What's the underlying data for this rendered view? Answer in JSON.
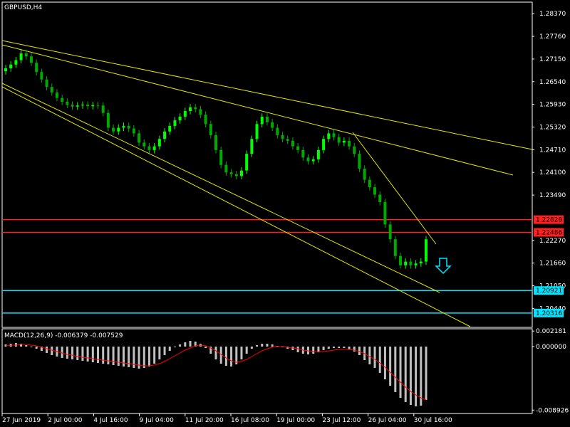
{
  "symbol_label": "GBPUSD,H4",
  "macd_label": "MACD(12,26,9) -0.006379 -0.007529",
  "colors": {
    "background": "#000000",
    "frame": "#ffffff",
    "bull_candle": "#00ff00",
    "bear_candle": "#00aa00",
    "trendline": "#e6e600",
    "resistance": "#ff2020",
    "support": "#00e5ff",
    "macd_hist": "#c0c0c0",
    "macd_signal": "#ff0000",
    "arrow": "#00e5ff"
  },
  "price_axis": {
    "min": 1.1993,
    "max": 1.2868,
    "ticks": [
      "1.28370",
      "1.27760",
      "1.27150",
      "1.26540",
      "1.25930",
      "1.25320",
      "1.24710",
      "1.24100",
      "1.23490",
      "1.22270",
      "1.21660",
      "1.21050",
      "1.20440"
    ]
  },
  "time_axis": {
    "labels": [
      "27 Jun 2019",
      "2 Jul 00:00",
      "4 Jul 16:00",
      "9 Jul 04:00",
      "11 Jul 20:00",
      "16 Jul 08:00",
      "19 Jul 00:00",
      "23 Jul 12:00",
      "26 Jul 04:00",
      "30 Jul 16:00"
    ]
  },
  "levels": {
    "resistance": [
      {
        "value": 1.22828,
        "label": "1.22828"
      },
      {
        "value": 1.22486,
        "label": "1.22486"
      }
    ],
    "support": [
      {
        "value": 1.20921,
        "label": "1.20921"
      },
      {
        "value": 1.20316,
        "label": "1.20316"
      }
    ]
  },
  "macd_axis": {
    "min": -0.0094,
    "max": 0.0025,
    "ticks": [
      "0.002181",
      "0.000000",
      "-0.008926"
    ]
  },
  "chart_data": {
    "type": "candlestick",
    "title": "GBPUSD,H4",
    "closes": [
      1.269,
      1.27,
      1.2712,
      1.273,
      1.2722,
      1.2705,
      1.268,
      1.266,
      1.264,
      1.2625,
      1.261,
      1.26,
      1.2592,
      1.2587,
      1.259,
      1.2592,
      1.2588,
      1.2591,
      1.259,
      1.257,
      1.253,
      1.252,
      1.253,
      1.2535,
      1.2528,
      1.2515,
      1.249,
      1.248,
      1.247,
      1.248,
      1.25,
      1.252,
      1.2535,
      1.255,
      1.256,
      1.2575,
      1.2585,
      1.258,
      1.2565,
      1.254,
      1.251,
      1.247,
      1.243,
      1.241,
      1.2405,
      1.24,
      1.2415,
      1.246,
      1.25,
      1.254,
      1.256,
      1.2545,
      1.253,
      1.251,
      1.25,
      1.2495,
      1.248,
      1.247,
      1.245,
      1.244,
      1.2445,
      1.247,
      1.25,
      1.2515,
      1.2505,
      1.249,
      1.2495,
      1.248,
      1.246,
      1.242,
      1.239,
      1.237,
      1.235,
      1.233,
      1.227,
      1.223,
      1.2185,
      1.216,
      1.217,
      1.216,
      1.2165,
      1.217,
      1.223
    ],
    "macd_histogram": [
      0.0003,
      0.0004,
      0.0005,
      0.0004,
      0.0002,
      0.0,
      -0.0003,
      -0.0006,
      -0.0009,
      -0.0012,
      -0.0014,
      -0.0016,
      -0.0017,
      -0.0018,
      -0.0019,
      -0.002,
      -0.0021,
      -0.0022,
      -0.0023,
      -0.0024,
      -0.0025,
      -0.0026,
      -0.0027,
      -0.0028,
      -0.0029,
      -0.003,
      -0.0031,
      -0.003,
      -0.0028,
      -0.0024,
      -0.0018,
      -0.0012,
      -0.0006,
      -0.0001,
      0.0003,
      0.0006,
      0.0008,
      0.0007,
      0.0004,
      -0.0002,
      -0.001,
      -0.0018,
      -0.0024,
      -0.0027,
      -0.0028,
      -0.0025,
      -0.0018,
      -0.001,
      -0.0003,
      0.0002,
      0.0004,
      0.0004,
      0.0003,
      0.0001,
      -0.0001,
      -0.0003,
      -0.0005,
      -0.0008,
      -0.001,
      -0.0011,
      -0.001,
      -0.0008,
      -0.0005,
      -0.0003,
      -0.0002,
      -0.0002,
      -0.0002,
      -0.0004,
      -0.0007,
      -0.0012,
      -0.0019,
      -0.0025,
      -0.003,
      -0.0037,
      -0.0046,
      -0.0055,
      -0.0064,
      -0.0072,
      -0.0078,
      -0.0082,
      -0.0084,
      -0.0083,
      -0.0075
    ],
    "macd_signal": [
      0.0001,
      0.0002,
      0.0002,
      0.0003,
      0.0003,
      0.0002,
      0.0001,
      -0.0001,
      -0.0003,
      -0.0005,
      -0.0007,
      -0.0009,
      -0.0011,
      -0.0012,
      -0.0014,
      -0.0015,
      -0.0016,
      -0.0017,
      -0.0018,
      -0.0019,
      -0.002,
      -0.0021,
      -0.0022,
      -0.0023,
      -0.0024,
      -0.0025,
      -0.0026,
      -0.0027,
      -0.0027,
      -0.0026,
      -0.0024,
      -0.0021,
      -0.0017,
      -0.0013,
      -0.0009,
      -0.0005,
      -0.0002,
      0.0001,
      0.0002,
      0.0001,
      -0.0002,
      -0.0006,
      -0.0011,
      -0.0016,
      -0.002,
      -0.0022,
      -0.0021,
      -0.0018,
      -0.0014,
      -0.001,
      -0.0006,
      -0.0003,
      -0.0001,
      0.0,
      0.0,
      -0.0001,
      -0.0002,
      -0.0003,
      -0.0005,
      -0.0006,
      -0.0007,
      -0.0007,
      -0.0007,
      -0.0006,
      -0.0005,
      -0.0004,
      -0.0004,
      -0.0004,
      -0.0005,
      -0.0007,
      -0.001,
      -0.0014,
      -0.0018,
      -0.0023,
      -0.0029,
      -0.0036,
      -0.0043,
      -0.005,
      -0.0057,
      -0.0063,
      -0.0068,
      -0.0072,
      -0.0075
    ]
  }
}
